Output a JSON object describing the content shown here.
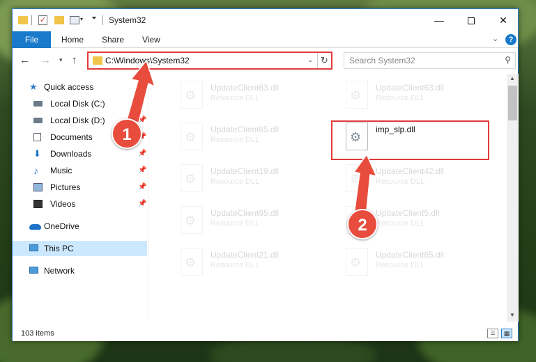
{
  "window": {
    "title": "System32",
    "minimize_glyph": "—",
    "close_glyph": "✕"
  },
  "ribbon": {
    "tabs": [
      "File",
      "Home",
      "Share",
      "View"
    ],
    "help_glyph": "?",
    "collapse_glyph": "⌄"
  },
  "nav": {
    "back_glyph": "←",
    "forward_glyph": "→",
    "recent_glyph": "▾",
    "up_glyph": "↑",
    "address": "C:\\Windows\\System32",
    "address_drop_glyph": "⌄",
    "refresh_glyph": "↻",
    "search_placeholder": "Search System32",
    "search_glyph": "⚲"
  },
  "sidebar": {
    "items": [
      {
        "label": "Quick access",
        "icon": "star-icon",
        "indent": 0,
        "pinned": false,
        "selected": false
      },
      {
        "label": "Local Disk (C:)",
        "icon": "drive-icon",
        "indent": 1,
        "pinned": false,
        "selected": false
      },
      {
        "label": "Local Disk (D:)",
        "icon": "drive-icon",
        "indent": 1,
        "pinned": true,
        "selected": false
      },
      {
        "label": "Documents",
        "icon": "documents-icon",
        "indent": 1,
        "pinned": true,
        "selected": false
      },
      {
        "label": "Downloads",
        "icon": "download-icon",
        "indent": 1,
        "pinned": true,
        "selected": false
      },
      {
        "label": "Music",
        "icon": "music-icon",
        "indent": 1,
        "pinned": true,
        "selected": false
      },
      {
        "label": "Pictures",
        "icon": "pictures-icon",
        "indent": 1,
        "pinned": true,
        "selected": false
      },
      {
        "label": "Videos",
        "icon": "videos-icon",
        "indent": 1,
        "pinned": true,
        "selected": false
      },
      {
        "label": "OneDrive",
        "icon": "cloud-icon",
        "indent": 0,
        "pinned": false,
        "selected": false
      },
      {
        "label": "This PC",
        "icon": "computer-icon",
        "indent": 0,
        "pinned": false,
        "selected": true
      },
      {
        "label": "Network",
        "icon": "network-icon",
        "indent": 0,
        "pinned": false,
        "selected": false
      }
    ],
    "pin_glyph": "📌"
  },
  "files": {
    "left_column": [
      {
        "name": "UpdateClient63.dll",
        "type": "Resource DLL"
      },
      {
        "name": "UpdateClient65.dll",
        "type": "Resource DLL"
      },
      {
        "name": "UpdateClient19.dll",
        "type": "Resource DLL"
      },
      {
        "name": "UpdateClient65.dll",
        "type": "Resource DLL"
      },
      {
        "name": "UpdateClient21.dll",
        "type": "Resource DLL"
      }
    ],
    "right_column": [
      {
        "name": "UpdateClient63.dll",
        "type": "Resource DLL",
        "highlighted": false
      },
      {
        "name": "imp_slp.dll",
        "type": "",
        "highlighted": true
      },
      {
        "name": "UpdateClient42.dll",
        "type": "Resource DLL",
        "highlighted": false
      },
      {
        "name": "UpdateClient5.dll",
        "type": "Resource DLL",
        "highlighted": false
      },
      {
        "name": "UpdateClient65.dll",
        "type": "Resource DLL",
        "highlighted": false
      }
    ]
  },
  "status": {
    "item_count": "103 items"
  },
  "annotations": {
    "step1": "1",
    "step2": "2",
    "color": "#e84c3d"
  }
}
